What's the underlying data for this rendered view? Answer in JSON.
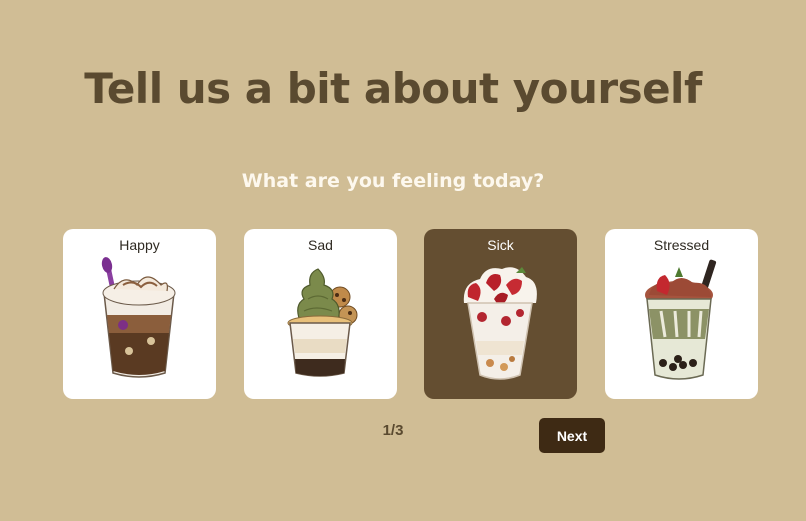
{
  "page": {
    "title": "Tell us a bit about yourself",
    "question": "What are you feeling today?"
  },
  "moods": [
    {
      "label": "Happy",
      "icon": "sundae-brownie-icon",
      "selected": false
    },
    {
      "label": "Sad",
      "icon": "matcha-soft-serve-icon",
      "selected": false
    },
    {
      "label": "Sick",
      "icon": "strawberry-parfait-icon",
      "selected": true
    },
    {
      "label": "Stressed",
      "icon": "bubble-tea-icon",
      "selected": false
    }
  ],
  "pagination": {
    "text": "1/3"
  },
  "actions": {
    "next_label": "Next"
  },
  "colors": {
    "background": "#d0bd95",
    "title": "#5a4a30",
    "subtitle": "#fdf8ee",
    "card": "#ffffff",
    "card_selected": "#644e31",
    "next_button": "#3e2a14"
  }
}
